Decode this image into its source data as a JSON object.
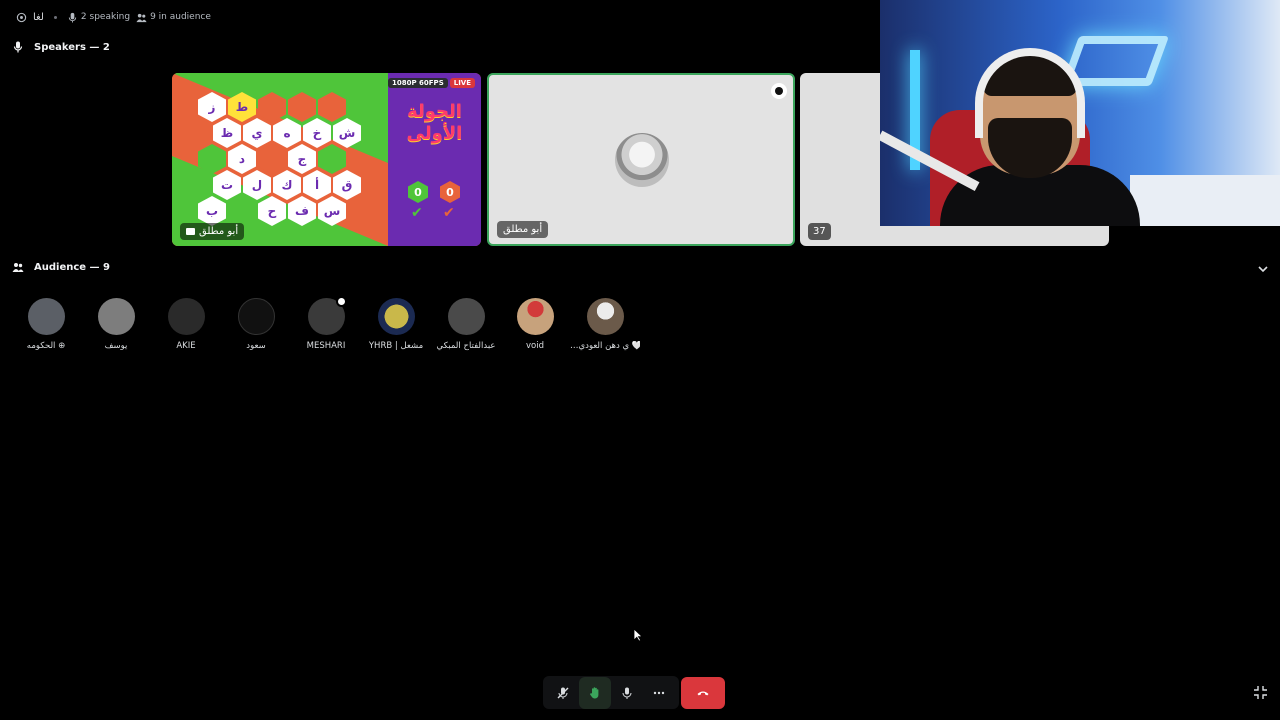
{
  "topbar": {
    "stage_name": "لغا",
    "speaking": "2 speaking",
    "audience_count": "9 in audience"
  },
  "speakers": {
    "header": "Speakers — 2",
    "tiles": [
      {
        "name": "أبو مطلق",
        "badge_resolution": "1080P 60FPS",
        "badge_live": "LIVE",
        "game": {
          "round_title_line1": "الجولة",
          "round_title_line2": "الأولى",
          "score_left": "0",
          "score_right": "0",
          "letters": [
            "ز",
            "ط",
            "ش",
            "ظ",
            "ي",
            "ه",
            "خ",
            "د",
            "ج",
            "ق",
            "أ",
            "ك",
            "ل",
            "ت",
            "ب",
            "ح",
            "ف",
            "س"
          ]
        }
      },
      {
        "name": "أبو مطلق"
      },
      {
        "count": "37"
      }
    ]
  },
  "audience": {
    "header": "Audience — 9",
    "members": [
      {
        "name": "الحكومه ⊕",
        "color": "#5b5f66"
      },
      {
        "name": "يوسف",
        "color": "#7d7d7d"
      },
      {
        "name": "AKIE",
        "color": "#2a2a2a"
      },
      {
        "name": "سعود",
        "color": "#111111"
      },
      {
        "name": "MESHARI",
        "color": "#3a3a3a"
      },
      {
        "name": "YHRB | مشعل",
        "color": "#1b2a52"
      },
      {
        "name": "عبدالفتاح المبكي",
        "color": "#4a4a4a"
      },
      {
        "name": "void",
        "color": "#c7a27c"
      },
      {
        "name": "…ي دهن العودي 🤍",
        "color": "#6b5a4a"
      }
    ]
  },
  "controls": {
    "mute_icon": "mic-off-icon",
    "raise_hand_icon": "hand-icon",
    "speak_icon": "request-speak-icon",
    "more_icon": "more-icon",
    "leave_icon": "phone-hangup-icon",
    "fullscreen_icon": "collapse-icon"
  },
  "colors": {
    "speaking_border": "#3ba55c",
    "leave_red": "#da373c",
    "background": "#000000"
  }
}
